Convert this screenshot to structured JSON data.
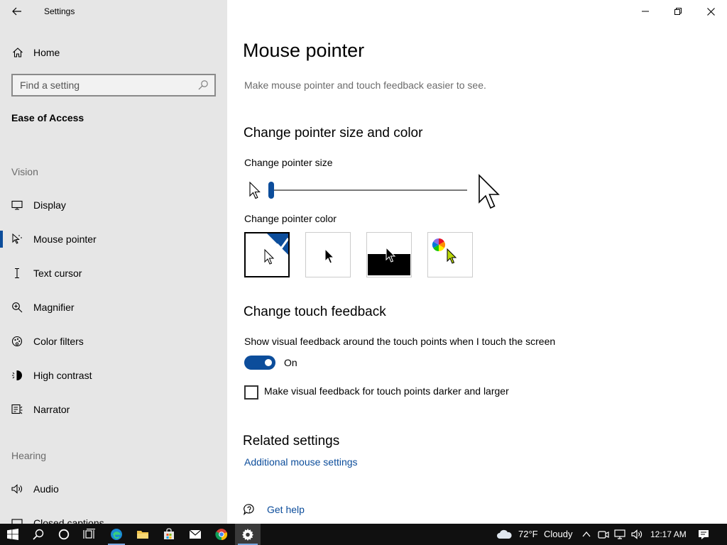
{
  "window": {
    "title": "Settings"
  },
  "sidebar": {
    "home_label": "Home",
    "search_placeholder": "Find a setting",
    "section_title": "Ease of Access",
    "vision_heading": "Vision",
    "vision_items": [
      {
        "label": "Display",
        "icon": "monitor-icon"
      },
      {
        "label": "Mouse pointer",
        "icon": "mouse-pointer-icon",
        "selected": true
      },
      {
        "label": "Text cursor",
        "icon": "text-cursor-icon"
      },
      {
        "label": "Magnifier",
        "icon": "magnifier-icon"
      },
      {
        "label": "Color filters",
        "icon": "color-filters-icon"
      },
      {
        "label": "High contrast",
        "icon": "high-contrast-icon"
      },
      {
        "label": "Narrator",
        "icon": "narrator-icon"
      }
    ],
    "hearing_heading": "Hearing",
    "hearing_items": [
      {
        "label": "Audio",
        "icon": "audio-icon"
      },
      {
        "label": "Closed captions",
        "icon": "closed-captions-icon"
      }
    ]
  },
  "main": {
    "title": "Mouse pointer",
    "description": "Make mouse pointer and touch feedback easier to see.",
    "size_color_heading": "Change pointer size and color",
    "pointer_size_label": "Change pointer size",
    "pointer_size_value": 1,
    "pointer_size_min": 1,
    "pointer_size_max": 15,
    "pointer_color_label": "Change pointer color",
    "pointer_colors": [
      {
        "name": "white",
        "selected": true
      },
      {
        "name": "black",
        "selected": false
      },
      {
        "name": "inverted",
        "selected": false
      },
      {
        "name": "custom",
        "selected": false
      }
    ],
    "touch_heading": "Change touch feedback",
    "touch_feedback_label": "Show visual feedback around the touch points when I touch the screen",
    "touch_feedback_state": "On",
    "darker_feedback_label": "Make visual feedback for touch points darker and larger",
    "darker_feedback_checked": false,
    "related_heading": "Related settings",
    "additional_mouse_link": "Additional mouse settings",
    "get_help_link": "Get help"
  },
  "taskbar": {
    "weather_temp": "72°F",
    "weather_condition": "Cloudy",
    "time": "12:17 AM"
  },
  "colors": {
    "accent": "#0c4d9b",
    "sidebar_bg": "#e6e6e6",
    "taskbar_bg": "#101010"
  }
}
